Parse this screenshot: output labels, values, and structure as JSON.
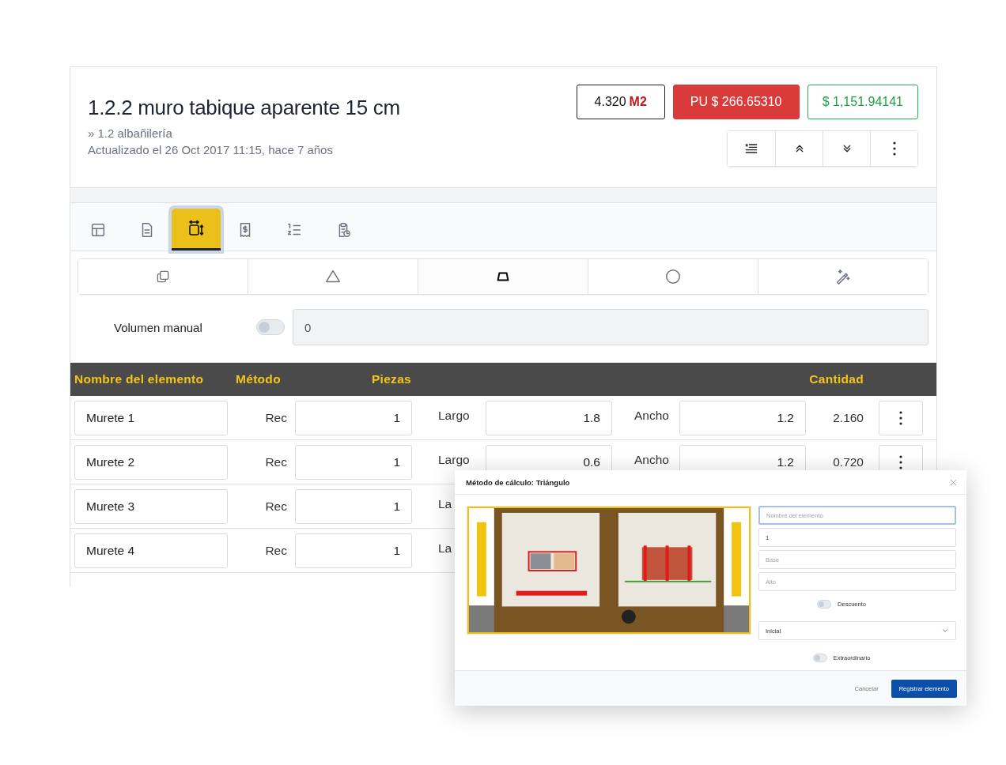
{
  "header": {
    "title": "1.2.2 muro tabique aparente 15 cm",
    "breadcrumb": "» 1.2 albañilería",
    "updated": "Actualizado el 26 Oct 2017 11:15, hace 7 años",
    "quantity": {
      "value": "4.320",
      "unit": "M2"
    },
    "unit_price": "PU $ 266.65310",
    "total": "$ 1,151.94141",
    "actions": [
      {
        "kind": "notes"
      },
      {
        "kind": "up"
      },
      {
        "kind": "down"
      },
      {
        "kind": "more"
      }
    ]
  },
  "tabs": [
    {
      "kind": "table",
      "selected": false
    },
    {
      "kind": "document",
      "selected": false
    },
    {
      "kind": "dimensions",
      "selected": true
    },
    {
      "kind": "receipt",
      "selected": false
    },
    {
      "kind": "list",
      "selected": false
    },
    {
      "kind": "schedule",
      "selected": false
    }
  ],
  "shape_buttons": [
    {
      "kind": "copy",
      "selected": false
    },
    {
      "kind": "triangle",
      "selected": false
    },
    {
      "kind": "trapezoid",
      "selected": true
    },
    {
      "kind": "circle",
      "selected": false
    },
    {
      "kind": "magic",
      "selected": false
    }
  ],
  "manual_volume": {
    "label": "Volumen manual",
    "on": false,
    "value": "0"
  },
  "table": {
    "columns": [
      "Nombre del elemento",
      "Método",
      "Piezas",
      "Cantidad"
    ],
    "rows": [
      {
        "name": "Murete 1",
        "method": "Rec",
        "pieces": "1",
        "label_1": "Largo",
        "value_1": "1.8",
        "label_2": "Ancho",
        "value_2": "1.2",
        "quantity": "2.160"
      },
      {
        "name": "Murete 2",
        "method": "Rec",
        "pieces": "1",
        "label_1": "Largo",
        "value_1": "0.6",
        "label_2": "Ancho",
        "value_2": "1.2",
        "quantity": "0.720"
      },
      {
        "name": "Murete 3",
        "method": "Rec",
        "pieces": "1",
        "label_1": "La"
      },
      {
        "name": "Murete 4",
        "method": "Rec",
        "pieces": "1",
        "label_1": "La"
      }
    ]
  },
  "modal": {
    "title": "Método de cálculo: Triángulo",
    "fields": [
      {
        "kind": "input",
        "placeholder": "Nombre del elemento",
        "focused": true
      },
      {
        "kind": "input",
        "value": "1",
        "focused": false
      },
      {
        "kind": "input",
        "placeholder": "Base",
        "focused": false
      },
      {
        "kind": "input",
        "placeholder": "Alto",
        "focused": false
      },
      {
        "kind": "toggle",
        "label": "Descuento",
        "on": false
      },
      {
        "kind": "select",
        "value": "Inicial"
      },
      {
        "kind": "toggle",
        "label": "Extraordinario",
        "on": false
      }
    ],
    "cancel": "Cancelar",
    "submit": "Registrar elemento"
  }
}
